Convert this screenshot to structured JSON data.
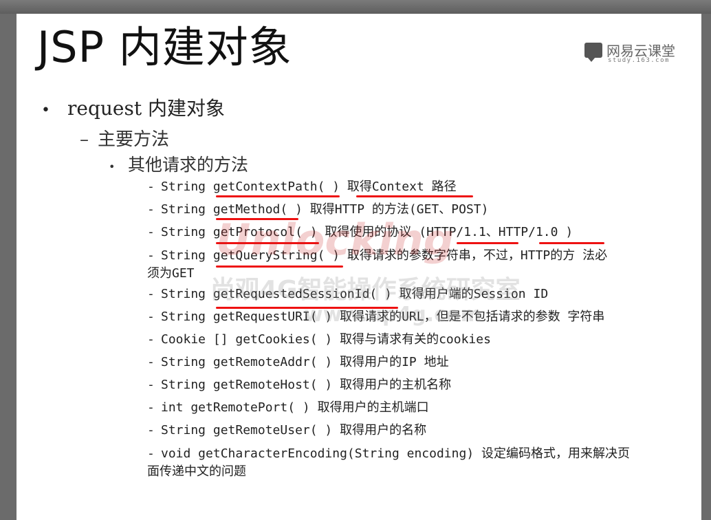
{
  "slide": {
    "title": "JSP 内建对象",
    "logo": {
      "name": "网易云课堂",
      "sub": "study.163.com"
    },
    "level1": "request 内建对象",
    "level2": "主要方法",
    "level3": "其他请求的方法",
    "bullet1": "•",
    "bullet2": "–",
    "bullet3": "•",
    "dash": "-",
    "items": [
      "String getContextPath( ) 取得Context 路径",
      "String getMethod( ) 取得HTTP 的方法(GET、POST)",
      "String getProtocol( ) 取得使用的协议 (HTTP/1.1、HTTP/1.0 )",
      "String getQueryString( ) 取得请求的参数字符串，不过，HTTP的方 法必",
      "须为GET",
      "String getRequestedSessionId( ) 取得用户端的Session ID",
      "String getRequestURI( ) 取得请求的URL，但是不包括请求的参数 字符串",
      "Cookie [] getCookies( ) 取得与请求有关的cookies",
      "String getRemoteAddr( ) 取得用户的IP 地址",
      "String getRemoteHost( ) 取得用户的主机名称",
      "int getRemotePort( ) 取得用户的主机端口",
      "String getRemoteUser( ) 取得用户的名称",
      "void getCharacterEncoding(String encoding) 设定编码格式，用来解决页",
      "面传递中文的问题"
    ]
  },
  "watermark": {
    "brand": "Unlocking",
    "line1": "尚观4G智能操作系统研究室",
    "line2": "www.up4g.com"
  },
  "colors": {
    "annotation": "#e11111",
    "text": "#222222",
    "background": "#ffffff"
  }
}
